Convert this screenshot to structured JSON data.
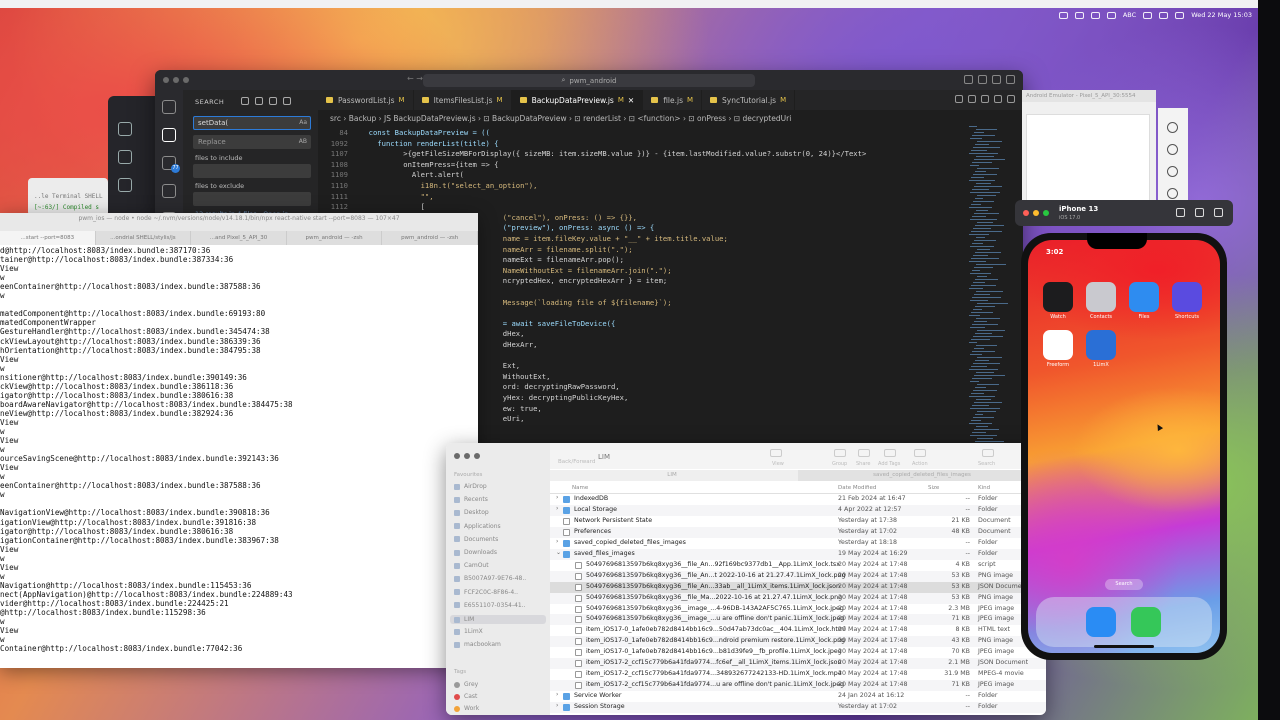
{
  "menubar": {
    "keyboard": "ABC",
    "datetime": "Wed 22 May  15:03"
  },
  "vscode": {
    "title": "pwm_android",
    "sidebar": {
      "title": "SEARCH",
      "search_value": "setData(",
      "replace_placeholder": "Replace",
      "replace_hint": "AB",
      "case_hint": "Aa",
      "files_include_label": "files to include",
      "files_exclude_label": "files to exclude",
      "results_text": "12 results in 4 files - Open in"
    },
    "tabs": [
      {
        "label": "PasswordList.js",
        "mod": "M"
      },
      {
        "label": "ItemsFilesList.js",
        "mod": "M"
      },
      {
        "label": "BackupDataPreview.js",
        "mod": "M"
      },
      {
        "label": "file.js",
        "mod": "M"
      },
      {
        "label": "SyncTutorial.js",
        "mod": "M"
      }
    ],
    "breadcrumb": "src › Backup › JS BackupDataPreview.js › ⊡ BackupDataPreview › ⊡ renderList › ⊡ <function> › ⊡ onPress › ⊡ decryptedUri",
    "code_lines": [
      {
        "ln": "84",
        "text": "  const BackupDataPreview = (("
      },
      {
        "ln": "1092",
        "text": "    function renderList(title) {"
      },
      {
        "ln": "1107",
        "text": "          >{getFileSizeMBForDisplay({ sizeMB: item.sizeMB.value })} - {item.lastModified.value?.substr(0, 24)}</Text>"
      },
      {
        "ln": "1108",
        "text": "          onItemPress={item => {"
      },
      {
        "ln": "1109",
        "text": "            Alert.alert("
      },
      {
        "ln": "1110",
        "text": "              i18n.t(\"select_an_option\"),"
      },
      {
        "ln": "1111",
        "text": "              \"\","
      },
      {
        "ln": "1112",
        "text": "              ["
      },
      {
        "ln": "",
        "text": "                                 (\"cancel\"), onPress: () => {}},"
      },
      {
        "ln": "",
        "text": "                                 (\"preview\"), onPress: async () => {"
      },
      {
        "ln": "",
        "text": "                                 name = item.fileKey.value + \"__\" + item.title.value;"
      },
      {
        "ln": "",
        "text": "                                 nameArr = filename.split(\".\");"
      },
      {
        "ln": "",
        "text": "                                 nameExt = filenameArr.pop();"
      },
      {
        "ln": "",
        "text": "                                 NameWithoutExt = filenameArr.join(\".\");"
      },
      {
        "ln": "",
        "text": "                                 ncryptedHex, encryptedHexArr } = item;"
      },
      {
        "ln": "",
        "text": ""
      },
      {
        "ln": "",
        "text": "                                 Message(`loading file of ${filename}`);"
      },
      {
        "ln": "",
        "text": ""
      },
      {
        "ln": "",
        "text": "                                 = await saveFileToDevice({"
      },
      {
        "ln": "",
        "text": "                                 dHex,"
      },
      {
        "ln": "",
        "text": "                                 dHexArr,"
      },
      {
        "ln": "",
        "text": ""
      },
      {
        "ln": "",
        "text": "                                 Ext,"
      },
      {
        "ln": "",
        "text": "                                 WithoutExt,"
      },
      {
        "ln": "",
        "text": "                                 ord: decryptingRawPassword,"
      },
      {
        "ln": "",
        "text": "                                 yHex: decryptingPublicKeyHex,"
      },
      {
        "ln": "",
        "text": "                                 ew: true,"
      },
      {
        "ln": "",
        "text": "                                 eUri,"
      }
    ]
  },
  "terminal": {
    "title": "pwm_ios — node • node ~/.nvm/versions/node/v14.18.1/bin/npx react-native start --port=8083 — 107×47",
    "tabs": [
      "...start --port=8083",
      "...ondrial SHELL/stylis/js",
      "...and Pixel_5_API_30",
      "pwm_android — -zsh",
      "pwm_android — -zsh"
    ],
    "small_terminal_lines": [
      "..le Terminal SHELL",
      "[~:63/] Compiled s"
    ],
    "lines": [
      "d@http://localhost:8083/index.bundle:387170:36",
      "tainer@http://localhost:8083/index.bundle:387334:36",
      "View",
      "w",
      "eenContainer@http://localhost:8083/index.bundle:387588:36",
      "w",
      "",
      "matedComponent@http://localhost:8083/index.bundle:69193:80",
      "matedComponentWrapper",
      "GestureHandler@http://localhost:8083/index.bundle:345474:38",
      "ckViewLayout@http://localhost:8083/index.bundle:386339:36",
      "hOrientation@http://localhost:8083/index.bundle:384795:38",
      "View",
      "w",
      "nsitioner@http://localhost:8083/index.bundle:390149:36",
      "ckView@http://localhost:8083/index.bundle:386118:36",
      "igator@http://localhost:8083/index.bundle:380616:38",
      "boardAwareNavigator@http://localhost:8083/index.bundle:384475:38",
      "neView@http://localhost:8083/index.bundle:382924:36",
      "View",
      "w",
      "View",
      "w",
      "ourceSavingScene@http://localhost:8083/index.bundle:392143:36",
      "View",
      "w",
      "eenContainer@http://localhost:8083/index.bundle:387588:36",
      "w",
      "",
      "NavigationView@http://localhost:8083/index.bundle:390818:36",
      "igationView@http://localhost:8083/index.bundle:391816:38",
      "igator@http://localhost:8083/index.bundle:380616:38",
      "igationContainer@http://localhost:8083/index.bundle:383967:38",
      "View",
      "w",
      "View",
      "w",
      "Navigation@http://localhost:8083/index.bundle:115453:36",
      "nect(AppNavigation)@http://localhost:8083/index.bundle:224889:43",
      "vider@http://localhost:8083/index.bundle:224425:21",
      "@http://localhost:8083/index.bundle:115298:36",
      "w",
      "View",
      "w",
      "Container@http://localhost:8083/index.bundle:77042:36"
    ]
  },
  "finder": {
    "title": "LIM",
    "back_label": "Back/Forward",
    "path_left": "LIM",
    "path_right": "saved_copied_deleted_files_images",
    "toolbar_labels": [
      "View",
      "Group",
      "Share",
      "Add Tags",
      "Action",
      "Search"
    ],
    "sidebar_head_favorites": "Favourites",
    "sidebar_head_tags": "Tags",
    "sidebar_items": [
      "AirDrop",
      "Recents",
      "Desktop",
      "Applications",
      "Documents",
      "Downloads",
      "CamOut",
      "B5007A97-9E76-48..",
      "FCF2C0C-8F86-4..",
      "E6551107-0354-41..",
      "LIM",
      "1LimX",
      "macbookam"
    ],
    "tags": [
      "Grey",
      "Cast",
      "Work"
    ],
    "columns": {
      "name": "Name",
      "date": "Date Modified",
      "size": "Size",
      "kind": "Kind"
    },
    "rows": [
      {
        "name": "IndexedDB",
        "date": "21 Feb 2024 at 16:47",
        "size": "--",
        "kind": "Folder",
        "type": "folder",
        "indent": 0,
        "tri": "›"
      },
      {
        "name": "Local Storage",
        "date": "4 Apr 2022 at 12:57",
        "size": "--",
        "kind": "Folder",
        "type": "folder",
        "indent": 0,
        "tri": "›"
      },
      {
        "name": "Network Persistent State",
        "date": "Yesterday at 17:38",
        "size": "21 KB",
        "kind": "Document",
        "type": "file",
        "indent": 0,
        "tri": ""
      },
      {
        "name": "Preferences",
        "date": "Yesterday at 17:02",
        "size": "48 KB",
        "kind": "Document",
        "type": "file",
        "indent": 0,
        "tri": ""
      },
      {
        "name": "saved_copied_deleted_files_images",
        "date": "Yesterday at 18:18",
        "size": "--",
        "kind": "Folder",
        "type": "folder",
        "indent": 0,
        "tri": "›"
      },
      {
        "name": "saved_files_images",
        "date": "19 May 2024 at 16:29",
        "size": "--",
        "kind": "Folder",
        "type": "folder",
        "indent": 0,
        "tri": "⌄"
      },
      {
        "name": "50497696813597b6kq8xyg36__file_An...92f169bc9377db1__App.1LimX_lock.tsx",
        "date": "20 May 2024 at 17:48",
        "size": "4 KB",
        "kind": "script",
        "type": "file",
        "indent": 1,
        "tri": ""
      },
      {
        "name": "50497696813597b6kq8xyg36__file_An...t 2022-10-16 at 21.27.47.1LimX_lock.png",
        "date": "20 May 2024 at 17:48",
        "size": "53 KB",
        "kind": "PNG image",
        "type": "file",
        "indent": 1,
        "tri": ""
      },
      {
        "name": "50497696813597b6kq8xyg36__file_An...33ab__all_1LimX_items.1LimX_lock.json",
        "date": "20 May 2024 at 17:48",
        "size": "53 KB",
        "kind": "JSON Document",
        "type": "file",
        "indent": 1,
        "tri": ""
      },
      {
        "name": "50497696813597b6kq8xyg36__file_Ma...2022-10-16 at 21.27.47.1LimX_lock.png",
        "date": "20 May 2024 at 17:48",
        "size": "53 KB",
        "kind": "PNG image",
        "type": "file",
        "indent": 1,
        "tri": ""
      },
      {
        "name": "50497696813597b6kq8xyg36__image_...4-96DB-143A2AF5C765.1LimX_lock.jpeg",
        "date": "20 May 2024 at 17:48",
        "size": "2.3 MB",
        "kind": "JPEG image",
        "type": "file",
        "indent": 1,
        "tri": ""
      },
      {
        "name": "50497696813597b6kq8xyg36__image_...u are offline don't panic.1LimX_lock.jpeg",
        "date": "20 May 2024 at 17:48",
        "size": "71 KB",
        "kind": "JPEG image",
        "type": "file",
        "indent": 1,
        "tri": ""
      },
      {
        "name": "item_iOS17-0_1afe0eb782d8414bb16c9...50d47ab73dc0ac__404.1LimX_lock.html",
        "date": "20 May 2024 at 17:48",
        "size": "8 KB",
        "kind": "HTML text",
        "type": "file",
        "indent": 1,
        "tri": ""
      },
      {
        "name": "item_iOS17-0_1afe0eb782d8414bb16c9...ndroid premium restore.1LimX_lock.png",
        "date": "20 May 2024 at 17:48",
        "size": "43 KB",
        "kind": "PNG image",
        "type": "file",
        "indent": 1,
        "tri": ""
      },
      {
        "name": "item_iOS17-0_1afe0eb782d8414bb16c9...b81d39fe9__fb_profile.1LimX_lock.jpeg",
        "date": "20 May 2024 at 17:48",
        "size": "70 KB",
        "kind": "JPEG image",
        "type": "file",
        "indent": 1,
        "tri": ""
      },
      {
        "name": "item_iOS17-2_ccf15c779b6a41fda9774...fc6ef__all_1LimX_items.1LimX_lock.json",
        "date": "20 May 2024 at 17:48",
        "size": "2.1 MB",
        "kind": "JSON Document",
        "type": "file",
        "indent": 1,
        "tri": ""
      },
      {
        "name": "item_iOS17-2_ccf15c779b6a41fda9774...348932677242133-HD.1LimX_lock.mp4",
        "date": "20 May 2024 at 17:48",
        "size": "31.9 MB",
        "kind": "MPEG-4 movie",
        "type": "file",
        "indent": 1,
        "tri": ""
      },
      {
        "name": "item_iOS17-2_ccf15c779b6a41fda9774...u are offline don't panic.1LimX_lock.jpeg",
        "date": "20 May 2024 at 17:48",
        "size": "71 KB",
        "kind": "JPEG image",
        "type": "file",
        "indent": 1,
        "tri": ""
      },
      {
        "name": "Service Worker",
        "date": "24 Jan 2024 at 16:12",
        "size": "--",
        "kind": "Folder",
        "type": "folder",
        "indent": 0,
        "tri": "›"
      },
      {
        "name": "Session Storage",
        "date": "Yesterday at 17:02",
        "size": "--",
        "kind": "Folder",
        "type": "folder",
        "indent": 0,
        "tri": "›"
      }
    ]
  },
  "android_emulator": {
    "title": "Android Emulator - Pixel_5_API_30:5554"
  },
  "simulator": {
    "device": "iPhone 13",
    "os": "iOS 17.0",
    "time": "3:02",
    "apps": [
      {
        "label": "Watch",
        "color": "#1c1c1e"
      },
      {
        "label": "Contacts",
        "color": "#c9c9cf"
      },
      {
        "label": "Files",
        "color": "#2e8cf0"
      },
      {
        "label": "Shortcuts",
        "color": "#5a4be0"
      },
      {
        "label": "Freeform",
        "color": "#ffffff"
      },
      {
        "label": "1LimX",
        "color": "#2a6fd6"
      }
    ],
    "search_label": "Search",
    "dock_apps": [
      {
        "name": "safari-icon",
        "color": "#2a8cf4"
      },
      {
        "name": "messages-icon",
        "color": "#35c759"
      }
    ]
  }
}
